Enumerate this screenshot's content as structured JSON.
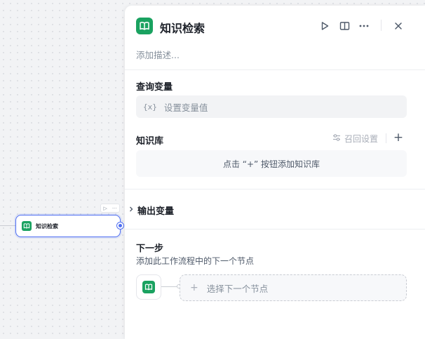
{
  "canvas": {
    "node_label": "知识检索",
    "toolbar_run": "▷",
    "toolbar_more": "···"
  },
  "panel": {
    "title": "知识检索",
    "description_placeholder": "添加描述...",
    "header_icons": [
      "play-icon",
      "book-icon",
      "more-icon",
      "close-icon"
    ],
    "query_section": {
      "title": "查询变量",
      "var_icon": "{x}",
      "placeholder": "设置变量值"
    },
    "knowledge_section": {
      "title": "知识库",
      "recall_label": "召回设置",
      "add_symbol": "+",
      "empty_text": "点击 “+” 按钮添加知识库"
    },
    "output_section": {
      "title": "输出变量"
    },
    "next_section": {
      "title": "下一步",
      "description": "添加此工作流程中的下一个节点",
      "plus": "+",
      "select_placeholder": "选择下一个节点"
    }
  },
  "colors": {
    "accent": "#4e6ef2",
    "knowledge_icon": "#1aa260"
  }
}
